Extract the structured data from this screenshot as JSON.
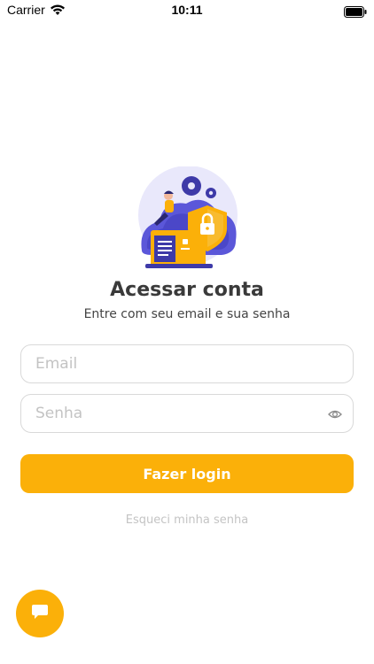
{
  "status_bar": {
    "carrier": "Carrier",
    "time": "10:11",
    "icons": [
      "wifi-icon",
      "battery-icon"
    ]
  },
  "login": {
    "title": "Acessar conta",
    "subtitle": "Entre com seu email e sua senha",
    "email_placeholder": "Email",
    "email_value": "",
    "password_placeholder": "Senha",
    "password_value": "",
    "password_toggle_icon": "eye-icon",
    "submit_label": "Fazer login",
    "forgot_label": "Esqueci minha senha"
  },
  "chat": {
    "icon": "chat-bubble-icon"
  },
  "colors": {
    "accent": "#FBB009",
    "title_text": "#3a3a3a",
    "placeholder": "#c3c3c3",
    "field_border": "#d9d9d9",
    "illustration_purple": "#5b57d9"
  }
}
